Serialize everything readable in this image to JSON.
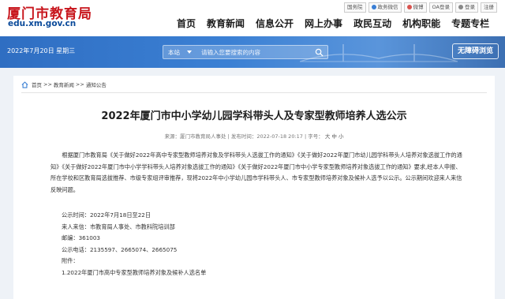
{
  "header": {
    "site_title": "厦门市教育局",
    "domain": "edu.xm.gov.cn",
    "top_links": [
      "国务院",
      "政务微信",
      "微博",
      "OA登录",
      "登录",
      "注册"
    ],
    "nav": [
      "首页",
      "教育新闻",
      "信息公开",
      "网上办事",
      "政民互动",
      "机构职能",
      "专题专栏"
    ]
  },
  "banner": {
    "date": "2022年7月20日 星期三",
    "search_scope": "本站",
    "search_placeholder": "请输入您要搜索的内容",
    "accessible_label": "无障碍浏览"
  },
  "breadcrumb": [
    "首页",
    ">>",
    "教育新闻",
    ">>",
    "通知公告"
  ],
  "article": {
    "title": "2022年厦门市中小学幼儿园学科带头人及专家型教师培养人选公示",
    "meta_source": "来源：厦门市教育局人事处 | 发布时间：2022-07-18 20:17 | 字号：",
    "font_sizes": [
      "大",
      "中",
      "小"
    ],
    "paragraph": "根据厦门市教育局《关于做好2022年高中专家型教师培养对象及学科带头人选拔工作的通知》《关于做好2022年厦门市幼儿园学科带头人培养对象选拔工作的通知》《关于做好2022年厦门市中小学学科带头人培养对象选拔工作的通知》《关于做好2022年厦门市中小学专家型教师培养对象选拔工作的通知》要求,经本人申报、所在学校和区教育局选拔推荐、市级专家组评审推荐，现将2022年中小学幼儿园市学科带头人、市专家型教师培养对象及候补人选予以公示。公示期间欢迎来人来信反映问题。",
    "info_lines": [
      "公示时间：2022年7月18日至22日",
      "来人来信：市教育局人事处、市教科院培训部",
      "邮编：361003",
      "公示电话：2135597、2665074、2665075",
      "附件：",
      "1.2022年厦门市高中专家型教师培养对象及候补人选名单"
    ]
  },
  "colors": {
    "brand_red": "#c8161d",
    "domain_blue": "#0a4a9a",
    "banner_blue": "#3b80d4"
  }
}
